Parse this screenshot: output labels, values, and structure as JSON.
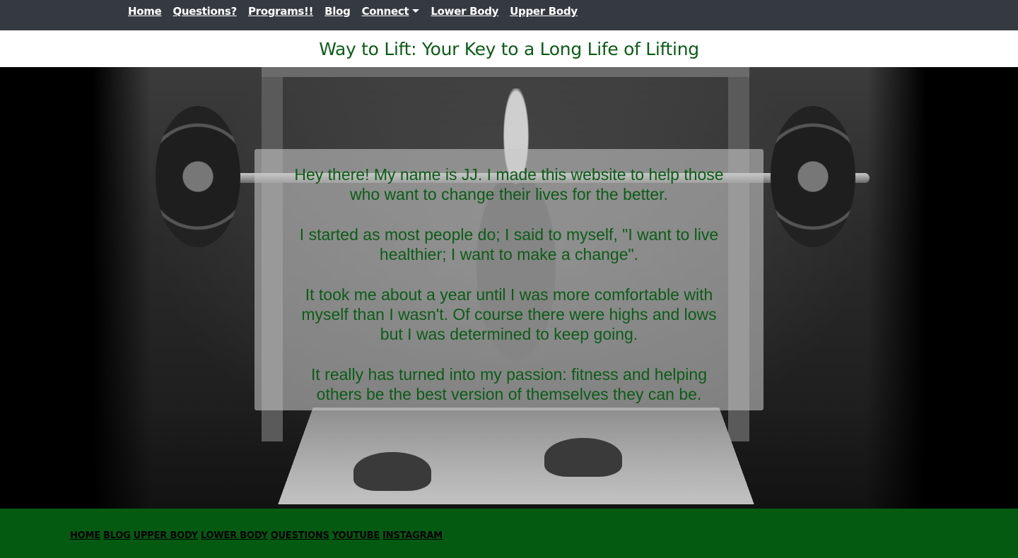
{
  "navbar": {
    "items": [
      {
        "label": "Home"
      },
      {
        "label": "Questions?"
      },
      {
        "label": "Programs!!"
      },
      {
        "label": "Blog"
      },
      {
        "label": "Connect"
      },
      {
        "label": "Lower Body"
      },
      {
        "label": "Upper Body"
      }
    ]
  },
  "header": {
    "title": "Way to Lift: Your Key to a Long Life of Lifting"
  },
  "hero": {
    "paragraphs": [
      "Hey there! My name is JJ. I made this website to help those who want to change their lives for the better.",
      "I started as most people do; I said to myself, \"I want to live healthier; I want to make a change\".",
      "It took me about a year until I was more comfortable with myself than I wasn't. Of course there were highs and lows but I was determined to keep going.",
      "It really has turned into my passion: fitness and helping others be the best version of themselves they can be."
    ]
  },
  "footer": {
    "links": [
      {
        "label": "Home"
      },
      {
        "label": "Blog"
      },
      {
        "label": "Upper Body"
      },
      {
        "label": "Lower Body"
      },
      {
        "label": "Questions"
      },
      {
        "label": "Youtube"
      },
      {
        "label": "Instagram"
      }
    ]
  },
  "colors": {
    "navbar_bg": "#343a40",
    "title_green": "#0b5d16",
    "footer_bg": "#055a12"
  }
}
